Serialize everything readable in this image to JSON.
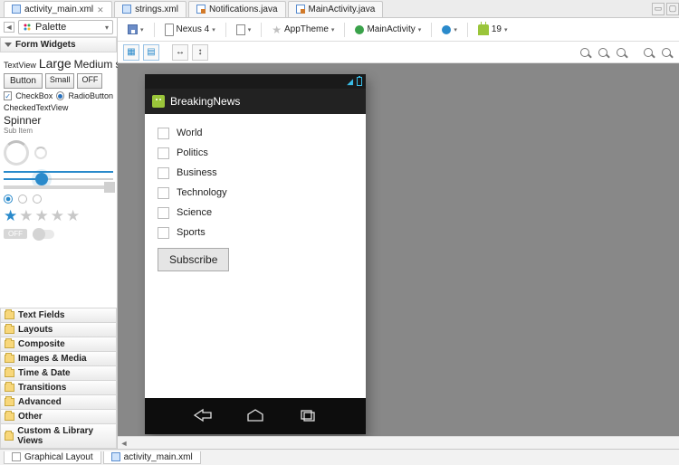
{
  "tabs": [
    {
      "label": "activity_main.xml",
      "type": "xml",
      "active": true,
      "closeable": true
    },
    {
      "label": "strings.xml",
      "type": "xml"
    },
    {
      "label": "Notifications.java",
      "type": "java"
    },
    {
      "label": "MainActivity.java",
      "type": "java"
    }
  ],
  "palette": {
    "title": "Palette",
    "section": "Form Widgets",
    "textview_label": "TextView",
    "large": "Large",
    "medium": "Medium",
    "small_tv": "Small",
    "button": "Button",
    "small_btn": "Small",
    "off": "OFF",
    "checkbox": "CheckBox",
    "radiobutton": "RadioButton",
    "checkedtextview": "CheckedTextView",
    "spinner": "Spinner",
    "subitem": "Sub Item",
    "off_pill": "OFF",
    "categories": [
      "Text Fields",
      "Layouts",
      "Composite",
      "Images & Media",
      "Time & Date",
      "Transitions",
      "Advanced",
      "Other",
      "Custom & Library Views"
    ]
  },
  "toolbar": {
    "device": "Nexus 4",
    "theme": "AppTheme",
    "activity": "MainActivity",
    "api": "19"
  },
  "phone": {
    "app_title": "BreakingNews",
    "items": [
      "World",
      "Politics",
      "Business",
      "Technology",
      "Science",
      "Sports"
    ],
    "subscribe": "Subscribe"
  },
  "bottom_tabs": {
    "graphical": "Graphical Layout",
    "source": "activity_main.xml"
  }
}
